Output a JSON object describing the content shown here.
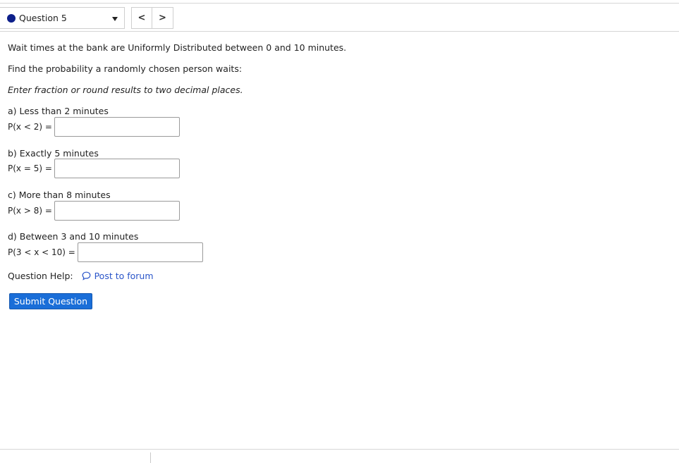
{
  "header": {
    "question_label": "Question 5",
    "prev_symbol": "<",
    "next_symbol": ">",
    "status_color": "#0d1f8a"
  },
  "body": {
    "intro": "Wait times at the bank are Uniformly Distributed between 0 and 10 minutes.",
    "instruction": "Find the probability a randomly chosen person waits:",
    "format_note": "Enter fraction or round results to two decimal places."
  },
  "parts": [
    {
      "label": "a) Less than 2 minutes",
      "expression": "P(x < 2) =",
      "value": ""
    },
    {
      "label": "b) Exactly 5 minutes",
      "expression": "P(x = 5) =",
      "value": ""
    },
    {
      "label": "c) More than 8 minutes",
      "expression": "P(x > 8) =",
      "value": ""
    },
    {
      "label": "d) Between 3 and 10 minutes",
      "expression": "P(3 < x < 10) =",
      "value": ""
    }
  ],
  "help": {
    "label": "Question Help:",
    "forum_link": "Post to forum"
  },
  "submit_label": "Submit Question",
  "colors": {
    "link": "#2a55c9",
    "button": "#1a6ed8"
  }
}
